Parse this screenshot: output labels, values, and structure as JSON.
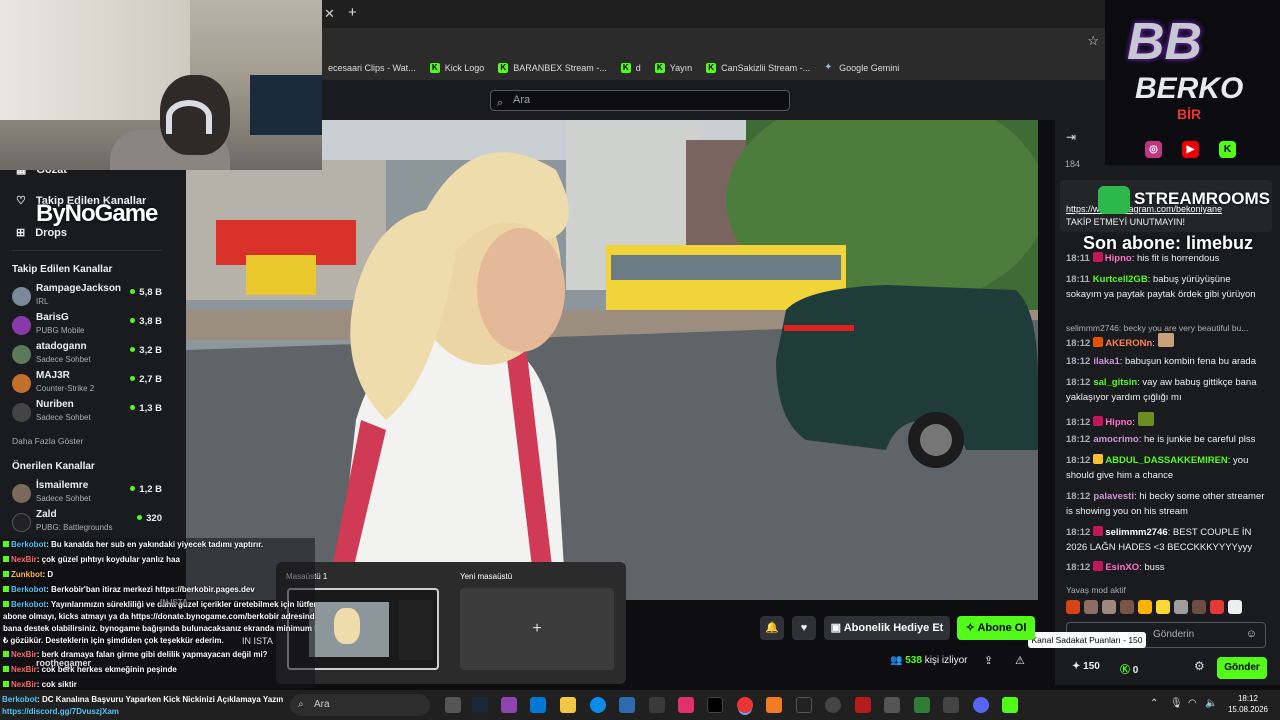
{
  "browser": {
    "bookmarks": [
      {
        "label": "ecesaari Clips - Wat...",
        "icon": "twitch-icon"
      },
      {
        "label": "Kick Logo",
        "icon": "kick-icon"
      },
      {
        "label": "BARANBEX Stream -...",
        "icon": "kick-icon"
      },
      {
        "label": "d",
        "icon": "kick-icon"
      },
      {
        "label": "Yayın",
        "icon": "kick-icon"
      },
      {
        "label": "CanSakizlii Stream -...",
        "icon": "kick-icon"
      },
      {
        "label": "Google Gemini",
        "icon": "gemini-icon"
      }
    ]
  },
  "header": {
    "search_placeholder": "Ara"
  },
  "sidebar": {
    "nav": [
      {
        "label": "Gözat",
        "icon": "browse-icon"
      },
      {
        "label": "Takip Edilen Kanallar",
        "icon": "heart-icon"
      },
      {
        "label": "Drops",
        "icon": "gift-icon"
      }
    ],
    "followed_title": "Takip Edilen Kanallar",
    "followed": [
      {
        "name": "RampageJackson",
        "category": "IRL",
        "viewers": "5,8 B",
        "color": "#7a8a9a"
      },
      {
        "name": "BarisG",
        "category": "PUBG Mobile",
        "viewers": "3,8 B",
        "color": "#8a3aa8"
      },
      {
        "name": "atadogann",
        "category": "Sadece Sohbet",
        "viewers": "3,2 B",
        "color": "#5a7a5a"
      },
      {
        "name": "MAJ3R",
        "category": "Counter-Strike 2",
        "viewers": "2,7 B",
        "color": "#c0702a"
      },
      {
        "name": "Nuriben",
        "category": "Sadece Sohbet",
        "viewers": "1,3 B",
        "color": "#444"
      }
    ],
    "more_label": "Daha Fazla Göster",
    "recommended_title": "Önerilen Kanallar",
    "recommended": [
      {
        "name": "İsmailemre",
        "category": "Sadece Sohbet",
        "viewers": "1,2 B",
        "color": "#7a6a5a"
      },
      {
        "name": "Zald",
        "category": "PUBG: Battlegrounds",
        "viewers": "320",
        "color": "#222"
      }
    ]
  },
  "overlay": {
    "bynogame": "ByNoGame",
    "stream_rooms": "STREAMROOMS",
    "son_abone": "Son abone: limebuz",
    "logo_bb": "BB",
    "logo_berko": "BERKO",
    "logo_bir": "BİR"
  },
  "chat": {
    "header_count": "184",
    "pinned_link": "https://www.instagram.com/bekoniyane",
    "pinned_text": "TAKİP ETMEYİ UNUTMAYIN!",
    "messages": [
      {
        "time": "18:11",
        "user": "Hipno",
        "text": "his fit is horrendous",
        "color": "#ff6ec7",
        "badge": "#c2185b"
      },
      {
        "time": "18:11",
        "user": "Kurtcell2GB",
        "text": "babuş yürüyüşüne sokayım ya paytak paytak ördek gibi yürüyon",
        "color": "#53fc18",
        "badge": ""
      },
      {
        "time": "18:12",
        "user": "AKERONn",
        "text": "",
        "color": "#ff7f50",
        "badge": "#e65100",
        "reply": "selimmm2746: becky you are very beautiful bu..."
      },
      {
        "time": "18:12",
        "user": "ilaka1",
        "text": "babuşun kombin fena bu arada",
        "color": "#ce93d8",
        "badge": ""
      },
      {
        "time": "18:12",
        "user": "sal_gitsin",
        "text": "vay aw babuş gittikçe bana yaklaşıyor yardım çığlığı mı",
        "color": "#53fc18",
        "badge": ""
      },
      {
        "time": "18:12",
        "user": "Hipno",
        "text": "",
        "color": "#ff6ec7",
        "badge": "#c2185b"
      },
      {
        "time": "18:12",
        "user": "amocrimo",
        "text": "he is junkie be careful plss",
        "color": "#ce93d8",
        "badge": ""
      },
      {
        "time": "18:12",
        "user": "ABDUL_DASSAKKEMIREN",
        "text": "you should give him a chance",
        "color": "#53fc18",
        "badge": "#fbc02d"
      },
      {
        "time": "18:12",
        "user": "palavesti",
        "text": "hi becky some other streamer is showing you on his stream",
        "color": "#ce93d8",
        "badge": ""
      },
      {
        "time": "18:12",
        "user": "selimmm2746",
        "text": "BEST COUPLE İN 2026 LAĞN HADES <3 BECCKKKYYYYyyy",
        "color": "#ffffff",
        "badge": "#c2185b"
      },
      {
        "time": "18:12",
        "user": "EsinXO",
        "text": "buss",
        "color": "#ff6ec7",
        "badge": "#c2185b"
      }
    ],
    "slow_mode": "Yavaş mod aktif",
    "input_placeholder": "Gönderin",
    "tooltip": "Kanal Sadakat Puanları - 150",
    "points": "150",
    "kick_points": "0",
    "send_label": "Gönder"
  },
  "actions": {
    "gift_sub": "Abonelik Hediye Et",
    "subscribe": "Abone Ol",
    "viewers_count": "538",
    "viewers_label": "kişi izliyor"
  },
  "desktops": {
    "desk1": "Masaüstü 1",
    "desk2": "Yeni masaüstü",
    "plus": "+"
  },
  "overlay_chat": [
    {
      "user": "Berkobot",
      "text": ": Bu kanalda her sub en yakındaki yiyecek tadımı yaptırır.",
      "cls": "n"
    },
    {
      "user": "NexBir",
      "text": ": çok güzel pıhtıyı koydular yanlız haa",
      "cls": "n2"
    },
    {
      "user": "Zunkbot",
      "text": ": D",
      "cls": "n3"
    },
    {
      "user": "Berkobot",
      "text": ": Berkobir'ban itiraz merkezi https://berkobir.pages.dev",
      "cls": "n"
    },
    {
      "user": "Berkobot",
      "text": ": Yayınlarımızın sürekliliği ve daha güzel içerikler üretebilmek için lütfen",
      "cls": "n"
    },
    {
      "user": "",
      "text": "abone olmayı, kicks atmayı ya da https://donate.bynogame.com/berkobir adresinden",
      "cls": "n"
    },
    {
      "user": "",
      "text": "bana destek olabilirsiniz. bynogame bağışında bulunacaksanız ekranda minimum 50",
      "cls": "n"
    },
    {
      "user": "",
      "text": "₺ gözükür. Desteklerin için şimdiden çok teşekkür ederim.",
      "cls": "n"
    },
    {
      "user": "NexBir",
      "text": ": berk dramaya falan girme gibi delilik yapmayacan değil mi?",
      "cls": "n2"
    },
    {
      "user": "NexBir",
      "text": ": cok berk herkes ekmeğinin peşinde",
      "cls": "n2"
    },
    {
      "user": "NexBir",
      "text": ": cok siktir",
      "cls": "n2"
    },
    {
      "user": "Berkobot",
      "text": ": DC Kanalına Başvuru Yaparken Kick Nickinizi Açıklamaya Yazın",
      "cls": "n"
    }
  ],
  "discord_link": "https://discord.gg/7DvuszjXam",
  "ghost_sidebar": [
    {
      "name": "IN ISTA",
      "viewers": ""
    },
    {
      "name": "roothegamer",
      "viewers": "1 B"
    },
    {
      "name": "Counter-Strike 2",
      "viewers": ""
    }
  ],
  "taskbar": {
    "search": "Ara",
    "time": "18:12",
    "date": "15.08.2026"
  }
}
